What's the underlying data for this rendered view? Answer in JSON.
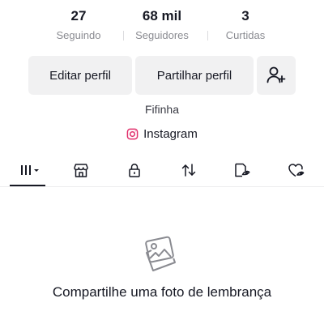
{
  "stats": [
    {
      "value": "27",
      "label": "Seguindo"
    },
    {
      "value": "68 mil",
      "label": "Seguidores"
    },
    {
      "value": "3",
      "label": "Curtidas"
    }
  ],
  "actions": {
    "edit_label": "Editar perfil",
    "share_label": "Partilhar perfil",
    "add_friend_icon": "add-user-icon"
  },
  "profile": {
    "name": "Fifinha",
    "link_label": "Instagram",
    "link_icon": "instagram-icon"
  },
  "tabs": [
    {
      "icon": "grid-videos-icon",
      "active": true
    },
    {
      "icon": "shop-icon",
      "active": false
    },
    {
      "icon": "lock-icon",
      "active": false
    },
    {
      "icon": "repost-icon",
      "active": false
    },
    {
      "icon": "saved-icon",
      "active": false
    },
    {
      "icon": "liked-icon",
      "active": false
    }
  ],
  "empty_state": {
    "icon": "photos-icon",
    "message": "Compartilhe uma foto de lembrança"
  },
  "colors": {
    "text": "#161823",
    "secondary_text": "#8a8b91",
    "button_bg": "#f1f1f2",
    "instagram": "#e1306c"
  }
}
